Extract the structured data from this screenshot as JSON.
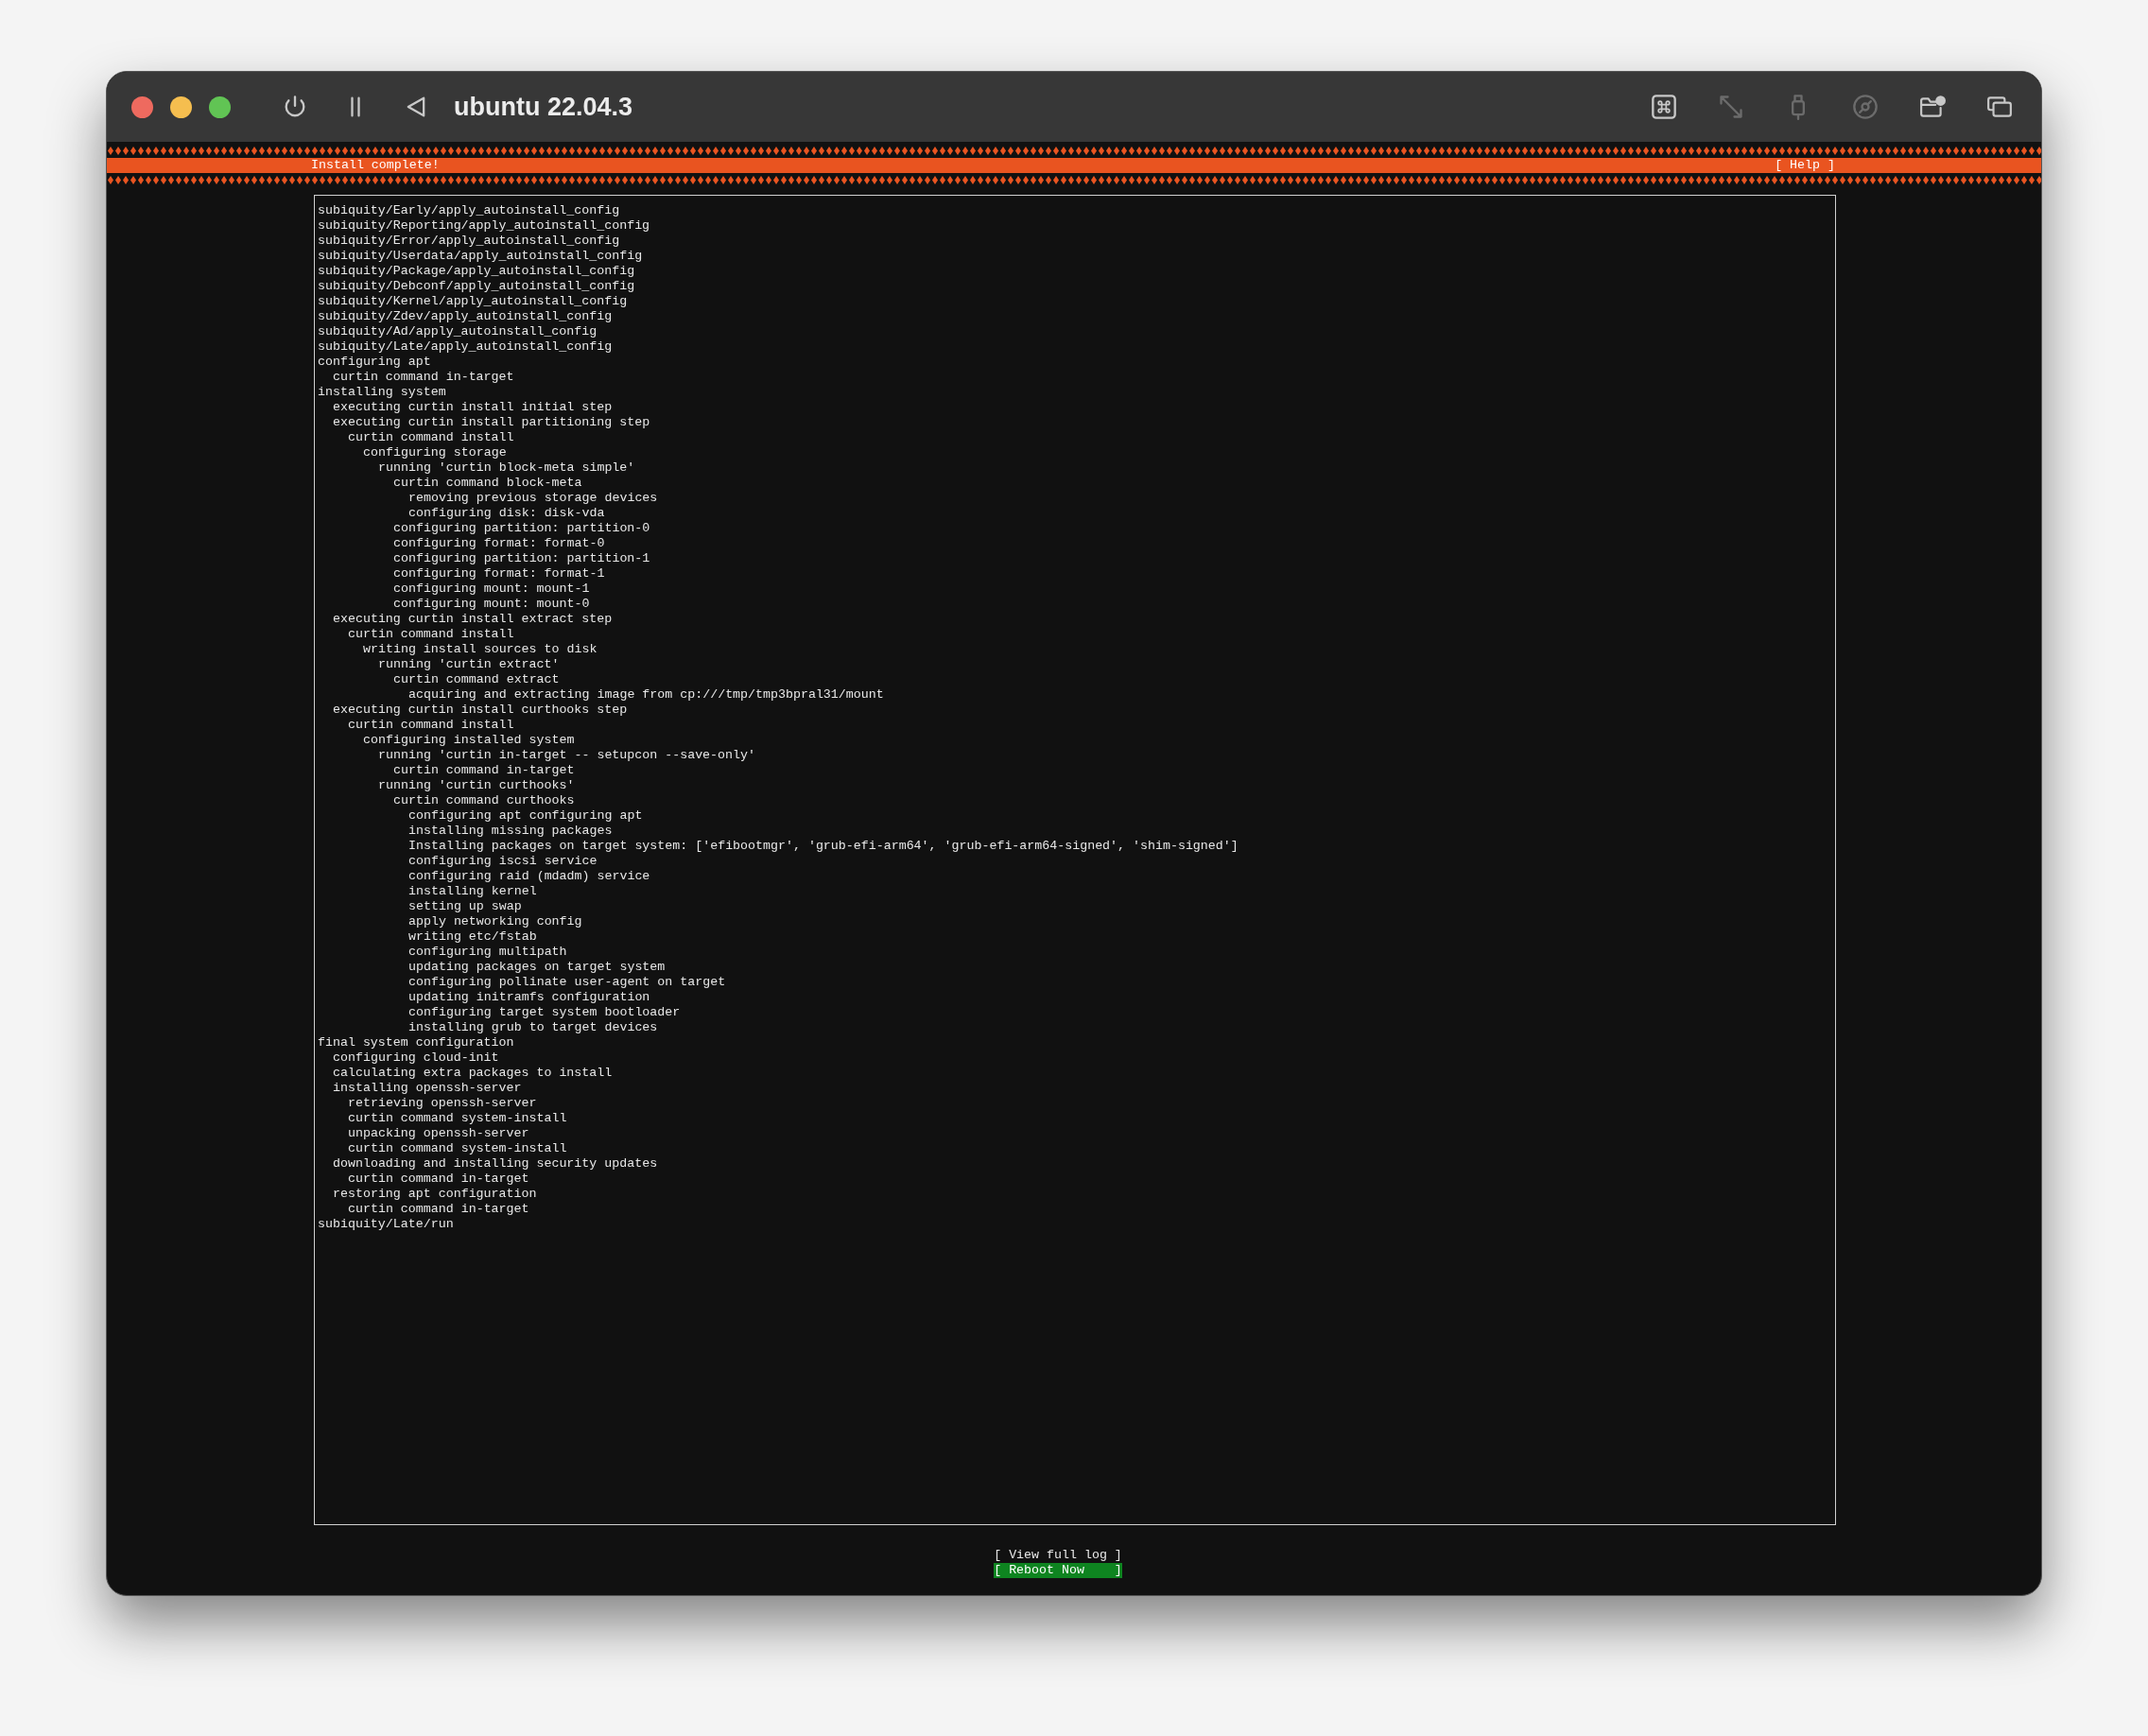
{
  "window": {
    "title": "ubuntu 22.04.3"
  },
  "toolbar_left": [
    {
      "kind": "power",
      "disabled": false
    },
    {
      "kind": "pause",
      "disabled": false
    },
    {
      "kind": "back",
      "disabled": false
    }
  ],
  "toolbar_right": [
    {
      "kind": "command",
      "disabled": false
    },
    {
      "kind": "resize",
      "disabled": true
    },
    {
      "kind": "usb",
      "disabled": true
    },
    {
      "kind": "disc",
      "disabled": true
    },
    {
      "kind": "shared-folder",
      "disabled": false
    },
    {
      "kind": "windows",
      "disabled": false
    }
  ],
  "header": {
    "title": "Install complete!",
    "help": "[ Help ]"
  },
  "log": [
    {
      "text": "subiquity/Early/apply_autoinstall_config"
    },
    {
      "text": "subiquity/Reporting/apply_autoinstall_config"
    },
    {
      "text": "subiquity/Error/apply_autoinstall_config"
    },
    {
      "text": "subiquity/Userdata/apply_autoinstall_config"
    },
    {
      "text": "subiquity/Package/apply_autoinstall_config"
    },
    {
      "text": "subiquity/Debconf/apply_autoinstall_config"
    },
    {
      "text": "subiquity/Kernel/apply_autoinstall_config"
    },
    {
      "text": "subiquity/Zdev/apply_autoinstall_config"
    },
    {
      "text": "subiquity/Ad/apply_autoinstall_config"
    },
    {
      "text": "subiquity/Late/apply_autoinstall_config"
    },
    {
      "text": "configuring apt",
      "children": [
        {
          "text": "curtin command in-target"
        }
      ]
    },
    {
      "text": "installing system",
      "children": [
        {
          "text": "executing curtin install initial step"
        },
        {
          "text": "executing curtin install partitioning step",
          "children": [
            {
              "text": "curtin command install",
              "children": [
                {
                  "text": "configuring storage",
                  "children": [
                    {
                      "text": "running 'curtin block-meta simple'",
                      "children": [
                        {
                          "text": "curtin command block-meta",
                          "children": [
                            {
                              "text": "removing previous storage devices"
                            },
                            {
                              "text": "configuring disk: disk-vda"
                            }
                          ]
                        },
                        {
                          "text": "configuring partition: partition-0"
                        },
                        {
                          "text": "configuring format: format-0"
                        },
                        {
                          "text": "configuring partition: partition-1"
                        },
                        {
                          "text": "configuring format: format-1"
                        },
                        {
                          "text": "configuring mount: mount-1"
                        },
                        {
                          "text": "configuring mount: mount-0"
                        }
                      ]
                    }
                  ]
                }
              ]
            }
          ]
        },
        {
          "text": "executing curtin install extract step",
          "children": [
            {
              "text": "curtin command install",
              "children": [
                {
                  "text": "writing install sources to disk",
                  "children": [
                    {
                      "text": "running 'curtin extract'",
                      "children": [
                        {
                          "text": "curtin command extract",
                          "children": [
                            {
                              "text": "acquiring and extracting image from cp:///tmp/tmp3bpral31/mount"
                            }
                          ]
                        }
                      ]
                    }
                  ]
                }
              ]
            }
          ]
        },
        {
          "text": "executing curtin install curthooks step",
          "children": [
            {
              "text": "curtin command install",
              "children": [
                {
                  "text": "configuring installed system",
                  "children": [
                    {
                      "text": "running 'curtin in-target -- setupcon --save-only'",
                      "children": [
                        {
                          "text": "curtin command in-target"
                        }
                      ]
                    },
                    {
                      "text": "running 'curtin curthooks'",
                      "children": [
                        {
                          "text": "curtin command curthooks",
                          "children": [
                            {
                              "text": "configuring apt configuring apt"
                            },
                            {
                              "text": "installing missing packages"
                            },
                            {
                              "text": "Installing packages on target system: ['efibootmgr', 'grub-efi-arm64', 'grub-efi-arm64-signed', 'shim-signed']"
                            },
                            {
                              "text": "configuring iscsi service"
                            },
                            {
                              "text": "configuring raid (mdadm) service"
                            },
                            {
                              "text": "installing kernel"
                            },
                            {
                              "text": "setting up swap"
                            },
                            {
                              "text": "apply networking config"
                            },
                            {
                              "text": "writing etc/fstab"
                            },
                            {
                              "text": "configuring multipath"
                            },
                            {
                              "text": "updating packages on target system"
                            },
                            {
                              "text": "configuring pollinate user-agent on target"
                            },
                            {
                              "text": "updating initramfs configuration"
                            },
                            {
                              "text": "configuring target system bootloader"
                            },
                            {
                              "text": "installing grub to target devices"
                            }
                          ]
                        }
                      ]
                    }
                  ]
                }
              ]
            }
          ]
        }
      ]
    },
    {
      "text": "final system configuration",
      "children": [
        {
          "text": "configuring cloud-init"
        },
        {
          "text": "calculating extra packages to install"
        },
        {
          "text": "installing openssh-server",
          "children": [
            {
              "text": "retrieving openssh-server"
            },
            {
              "text": "curtin command system-install"
            },
            {
              "text": "unpacking openssh-server"
            },
            {
              "text": "curtin command system-install"
            }
          ]
        },
        {
          "text": "downloading and installing security updates",
          "children": [
            {
              "text": "curtin command in-target"
            }
          ]
        },
        {
          "text": "restoring apt configuration",
          "children": [
            {
              "text": "curtin command in-target"
            }
          ]
        }
      ]
    },
    {
      "text": "subiquity/Late/run"
    }
  ],
  "buttons": [
    {
      "label": "[ View full log ]",
      "selected": false
    },
    {
      "label": "[ Reboot Now    ]",
      "selected": true
    }
  ]
}
